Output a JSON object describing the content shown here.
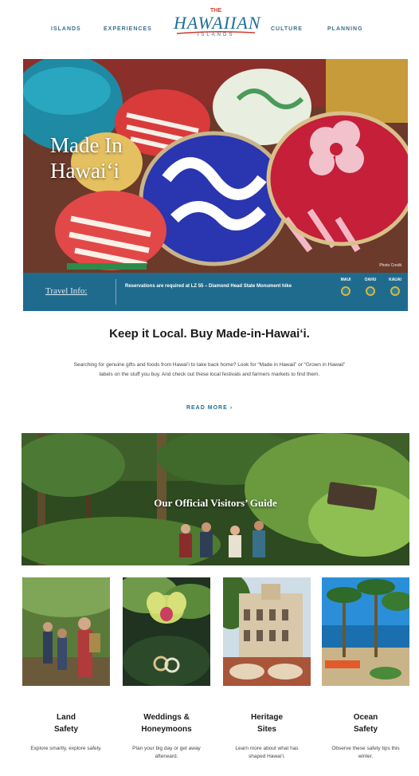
{
  "nav": {
    "left_links": [
      "ISLANDS",
      "EXPERIENCES"
    ],
    "right_links": [
      "CULTURE",
      "PLANNING"
    ],
    "logo": {
      "top": "THE",
      "main": "HAWAIIAN",
      "sub": "ISLANDS"
    }
  },
  "hero": {
    "title": "Made In Hawai‘i",
    "credit": "Photo Credit",
    "travel_label": "Travel Info:",
    "travel_text": "Reservations are required at LZ 55 – Diamond Head State Monument hike",
    "islands": [
      "MAUI",
      "OAHU",
      "KAUAI"
    ]
  },
  "local": {
    "headline": "Keep it Local. Buy Made-in-Hawai‘i.",
    "body": "Searching for genuine gifts and foods from Hawai‘i to take back home? Look for “Made in Hawaii” or “Grown in Hawaii” labels on the stuff you buy. And check out these local festivals and farmers markets to find them.",
    "read_more": "READ MORE"
  },
  "guide": {
    "title": "Our Official Visitors’ Guide"
  },
  "cards": [
    {
      "title_line1": "Land",
      "title_line2": "Safety",
      "desc": "Explore smartly, explore safely."
    },
    {
      "title_line1": "Weddings &",
      "title_line2": "Honeymoons",
      "desc": "Plan your big day or get away afterward."
    },
    {
      "title_line1": "Heritage",
      "title_line2": "Sites",
      "desc": "Learn more about what has shaped Hawai‘i."
    },
    {
      "title_line1": "Ocean",
      "title_line2": "Safety",
      "desc": "Observe these safety tips this winter."
    }
  ],
  "colors": {
    "brand_blue": "#1d6f95",
    "bar_blue": "#1f6b8e",
    "accent_red": "#d23b2f"
  }
}
